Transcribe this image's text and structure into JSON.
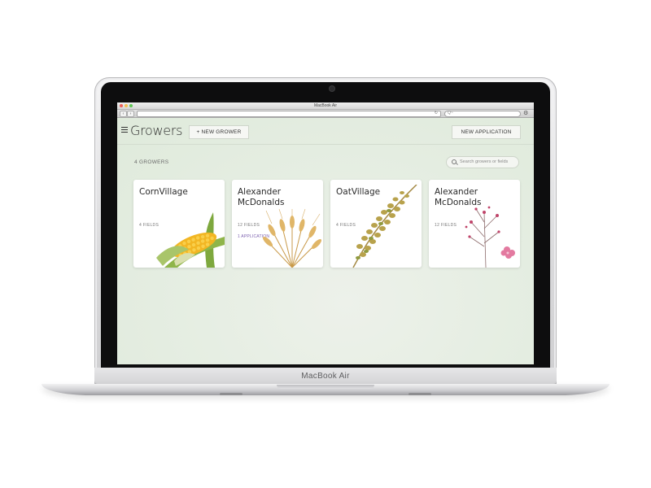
{
  "device": {
    "brand": "MacBook Air"
  },
  "browser": {
    "window_title": "MacBook Air",
    "search_placeholder": "Q~"
  },
  "header": {
    "title": "Growers",
    "new_grower_label": "+ NEW GROWER",
    "new_application_label": "NEW APPLICATION"
  },
  "toolbar": {
    "count_label": "4 GROWERS",
    "search_placeholder": "Search growers or fields"
  },
  "growers": [
    {
      "name": "CornVillage",
      "fields": "4 FIELDS",
      "applications": "",
      "crop": "corn"
    },
    {
      "name": "Alexander McDonalds",
      "fields": "12 FIELDS",
      "applications": "1 APPLICATION",
      "crop": "wheat"
    },
    {
      "name": "OatVillage",
      "fields": "4 FIELDS",
      "applications": "",
      "crop": "oat"
    },
    {
      "name": "Alexander McDonalds",
      "fields": "12 FIELDS",
      "applications": "",
      "crop": "flower"
    }
  ],
  "colors": {
    "app_background": "#e6eee3",
    "accent_application": "#7b5fae",
    "card": "#ffffff"
  }
}
